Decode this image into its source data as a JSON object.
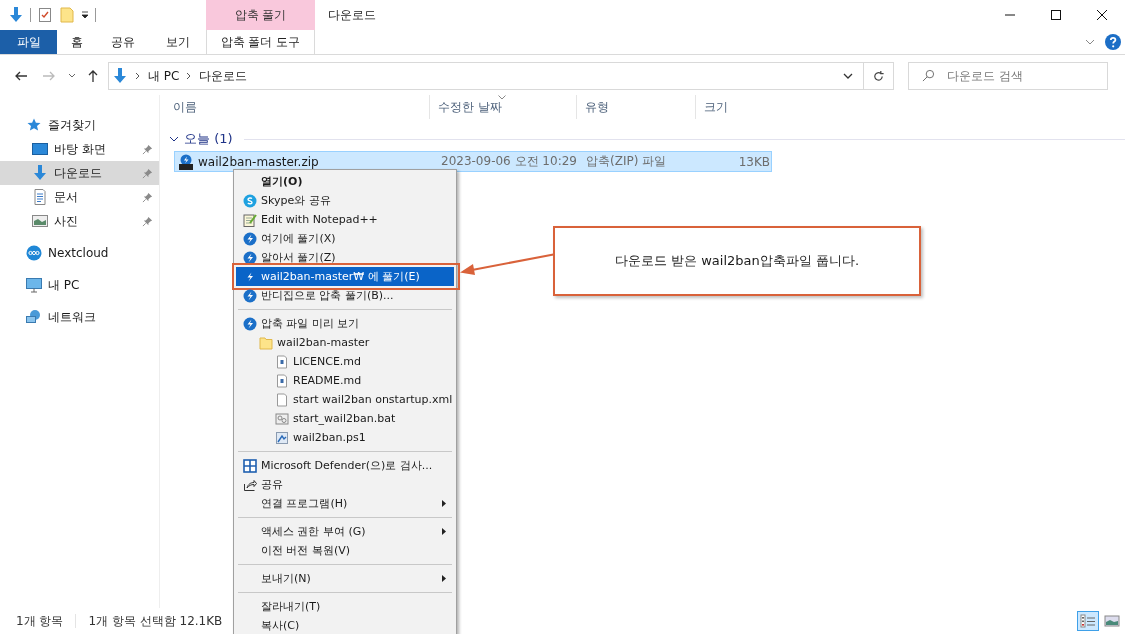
{
  "title_bar": {
    "contextual_group": "압축 풀기",
    "title": "다운로드"
  },
  "ribbon_tabs": [
    {
      "label": "파일",
      "kind": "file"
    },
    {
      "label": "홈",
      "kind": "tab"
    },
    {
      "label": "공유",
      "kind": "tab"
    },
    {
      "label": "보기",
      "kind": "tab"
    },
    {
      "label": "압축 폴더 도구",
      "kind": "contextual"
    }
  ],
  "address_bar": {
    "path": [
      "내 PC",
      "다운로드"
    ]
  },
  "search": {
    "placeholder": "다운로드 검색"
  },
  "sidebar": {
    "items": [
      {
        "label": "즐겨찾기",
        "kind": "star",
        "selected": false,
        "pinned": false,
        "indent": false
      },
      {
        "label": "바탕 화면",
        "kind": "desktop",
        "selected": false,
        "pinned": true,
        "indent": true
      },
      {
        "label": "다운로드",
        "kind": "download",
        "selected": true,
        "pinned": true,
        "indent": true
      },
      {
        "label": "문서",
        "kind": "document",
        "selected": false,
        "pinned": true,
        "indent": true
      },
      {
        "label": "사진",
        "kind": "pictures",
        "selected": false,
        "pinned": true,
        "indent": true
      },
      {
        "label": "Nextcloud",
        "kind": "cloud",
        "selected": false,
        "pinned": false,
        "indent": false
      },
      {
        "label": "내 PC",
        "kind": "pc",
        "selected": false,
        "pinned": false,
        "indent": false
      },
      {
        "label": "네트워크",
        "kind": "network",
        "selected": false,
        "pinned": false,
        "indent": false
      }
    ]
  },
  "columns": [
    {
      "label": "이름",
      "sorted": false
    },
    {
      "label": "수정한 날짜",
      "sorted": true
    },
    {
      "label": "유형",
      "sorted": false
    },
    {
      "label": "크기",
      "sorted": false
    }
  ],
  "groups": [
    {
      "label": "오늘 (1)",
      "expanded": true,
      "files": [
        {
          "name": "wail2ban-master.zip",
          "modified": "2023-09-06 오전 10:29",
          "type": "압축(ZIP) 파일",
          "size": "13KB",
          "selected": true
        }
      ]
    }
  ],
  "context_menu": {
    "items": [
      {
        "kind": "plain",
        "label": "열기(O)",
        "bold": true,
        "highlighted": false,
        "submenu": false,
        "annotated": false
      },
      {
        "kind": "skype",
        "label": "Skype와 공유",
        "bold": false,
        "highlighted": false,
        "submenu": false,
        "annotated": false
      },
      {
        "kind": "notepad",
        "label": "Edit with Notepad++",
        "bold": false,
        "highlighted": false,
        "submenu": false,
        "annotated": false
      },
      {
        "kind": "bandizip",
        "label": "여기에 풀기(X)",
        "bold": false,
        "highlighted": false,
        "submenu": false,
        "annotated": false
      },
      {
        "kind": "bandizip",
        "label": "알아서 풀기(Z)",
        "bold": false,
        "highlighted": false,
        "submenu": false,
        "annotated": false
      },
      {
        "kind": "bandizip",
        "label": "wail2ban-master₩ 에 풀기(E)",
        "bold": false,
        "highlighted": true,
        "submenu": false,
        "annotated": true
      },
      {
        "kind": "bandizip",
        "label": "반디집으로 압축 풀기(B)...",
        "bold": false,
        "highlighted": false,
        "submenu": false,
        "annotated": false
      },
      {
        "kind": "separator"
      },
      {
        "kind": "preview",
        "label": "압축 파일 미리 보기",
        "children": [
          {
            "label": "wail2ban-master",
            "kind": "folder",
            "children": [
              {
                "label": "LICENCE.md",
                "kind": "md"
              },
              {
                "label": "README.md",
                "kind": "md"
              },
              {
                "label": "start wail2ban onstartup.xml",
                "kind": "blank"
              },
              {
                "label": "start_wail2ban.bat",
                "kind": "bat"
              },
              {
                "label": "wail2ban.ps1",
                "kind": "ps1"
              }
            ]
          }
        ]
      },
      {
        "kind": "separator"
      },
      {
        "kind": "defender",
        "label": "Microsoft Defender(으)로 검사...",
        "bold": false,
        "highlighted": false,
        "submenu": false,
        "annotated": false
      },
      {
        "kind": "share",
        "label": "공유",
        "bold": false,
        "highlighted": false,
        "submenu": false,
        "annotated": false
      },
      {
        "kind": "plain",
        "label": "연결 프로그램(H)",
        "bold": false,
        "highlighted": false,
        "submenu": true,
        "annotated": false
      },
      {
        "kind": "separator"
      },
      {
        "kind": "plain",
        "label": "액세스 권한 부여 (G)",
        "bold": false,
        "highlighted": false,
        "submenu": true,
        "annotated": false
      },
      {
        "kind": "plain",
        "label": "이전 버전 복원(V)",
        "bold": false,
        "highlighted": false,
        "submenu": false,
        "annotated": false
      },
      {
        "kind": "separator"
      },
      {
        "kind": "plain",
        "label": "보내기(N)",
        "bold": false,
        "highlighted": false,
        "submenu": true,
        "annotated": false
      },
      {
        "kind": "separator"
      },
      {
        "kind": "plain",
        "label": "잘라내기(T)",
        "bold": false,
        "highlighted": false,
        "submenu": false,
        "annotated": false
      },
      {
        "kind": "plain",
        "label": "복사(C)",
        "bold": false,
        "highlighted": false,
        "submenu": false,
        "annotated": false
      }
    ]
  },
  "annotation": {
    "text": "다운로드 받은 wail2ban압축파일 풉니다."
  },
  "status_bar": {
    "item_count": "1개 항목",
    "selection": "1개 항목 선택함 12.1KB"
  },
  "view_buttons": [
    {
      "kind": "details",
      "selected": true
    },
    {
      "kind": "large_icons",
      "selected": false
    }
  ]
}
